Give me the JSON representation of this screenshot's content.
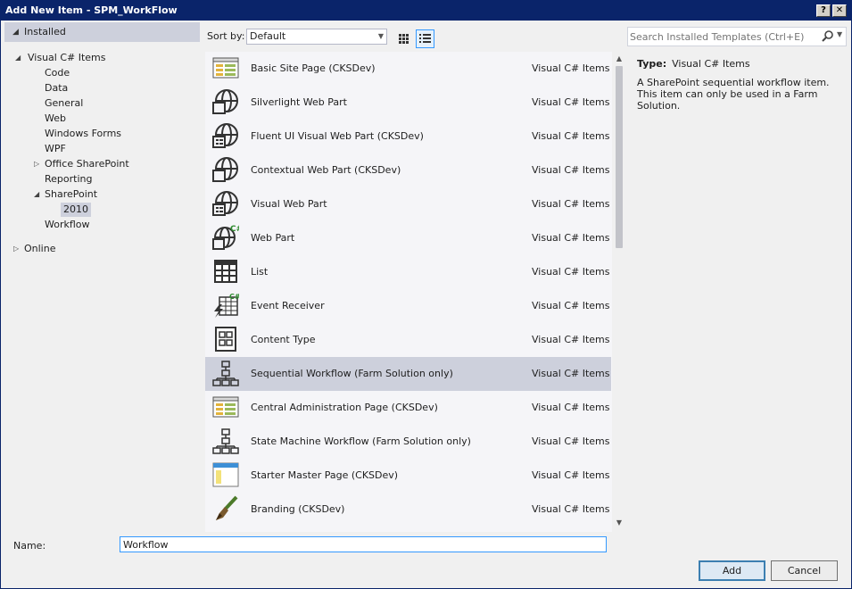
{
  "window": {
    "title": "Add New Item - SPM_WorkFlow",
    "help_glyph": "?",
    "close_glyph": "✕"
  },
  "sidebar": {
    "installed_label": "Installed",
    "root_label": "Visual C# Items",
    "items": [
      {
        "label": "Code"
      },
      {
        "label": "Data"
      },
      {
        "label": "General"
      },
      {
        "label": "Web"
      },
      {
        "label": "Windows Forms"
      },
      {
        "label": "WPF"
      },
      {
        "label": "Office SharePoint"
      },
      {
        "label": "Reporting"
      },
      {
        "label": "SharePoint"
      },
      {
        "label": "2010"
      },
      {
        "label": "Workflow"
      }
    ],
    "online_label": "Online"
  },
  "toolbar": {
    "sort_label": "Sort by:",
    "sort_value": "Default"
  },
  "search": {
    "placeholder": "Search Installed Templates (Ctrl+E)"
  },
  "templates": [
    {
      "name": "Basic Site Page (CKSDev)",
      "category": "Visual C# Items",
      "icon": "page-icon"
    },
    {
      "name": "Silverlight Web Part",
      "category": "Visual C# Items",
      "icon": "globe-webpart-icon"
    },
    {
      "name": "Fluent UI Visual Web Part (CKSDev)",
      "category": "Visual C# Items",
      "icon": "globe-visual-webpart-icon"
    },
    {
      "name": "Contextual Web Part (CKSDev)",
      "category": "Visual C# Items",
      "icon": "globe-webpart-icon"
    },
    {
      "name": "Visual Web Part",
      "category": "Visual C# Items",
      "icon": "globe-visual-webpart-icon"
    },
    {
      "name": "Web Part",
      "category": "Visual C# Items",
      "icon": "globe-csharp-icon"
    },
    {
      "name": "List",
      "category": "Visual C# Items",
      "icon": "list-icon"
    },
    {
      "name": "Event Receiver",
      "category": "Visual C# Items",
      "icon": "event-receiver-icon"
    },
    {
      "name": "Content Type",
      "category": "Visual C# Items",
      "icon": "content-type-icon"
    },
    {
      "name": "Sequential Workflow (Farm Solution only)",
      "category": "Visual C# Items",
      "icon": "workflow-icon"
    },
    {
      "name": "Central Administration Page (CKSDev)",
      "category": "Visual C# Items",
      "icon": "page-icon"
    },
    {
      "name": "State Machine Workflow (Farm Solution only)",
      "category": "Visual C# Items",
      "icon": "workflow-icon"
    },
    {
      "name": "Starter Master Page (CKSDev)",
      "category": "Visual C# Items",
      "icon": "master-page-icon"
    },
    {
      "name": "Branding (CKSDev)",
      "category": "Visual C# Items",
      "icon": "brush-icon"
    }
  ],
  "selected_template_index": 9,
  "details": {
    "type_label": "Type:",
    "type_value": "Visual C# Items",
    "description": "A SharePoint sequential workflow item. This item can only be used in a Farm Solution."
  },
  "name_field": {
    "label": "Name:",
    "value": "Workflow"
  },
  "buttons": {
    "add": "Add",
    "cancel": "Cancel"
  },
  "colors": {
    "title_bar": "#0a246a",
    "selection": "#cdd0dc",
    "focus_border": "#3399ff",
    "csharp_accent": "#2e8b2e"
  }
}
